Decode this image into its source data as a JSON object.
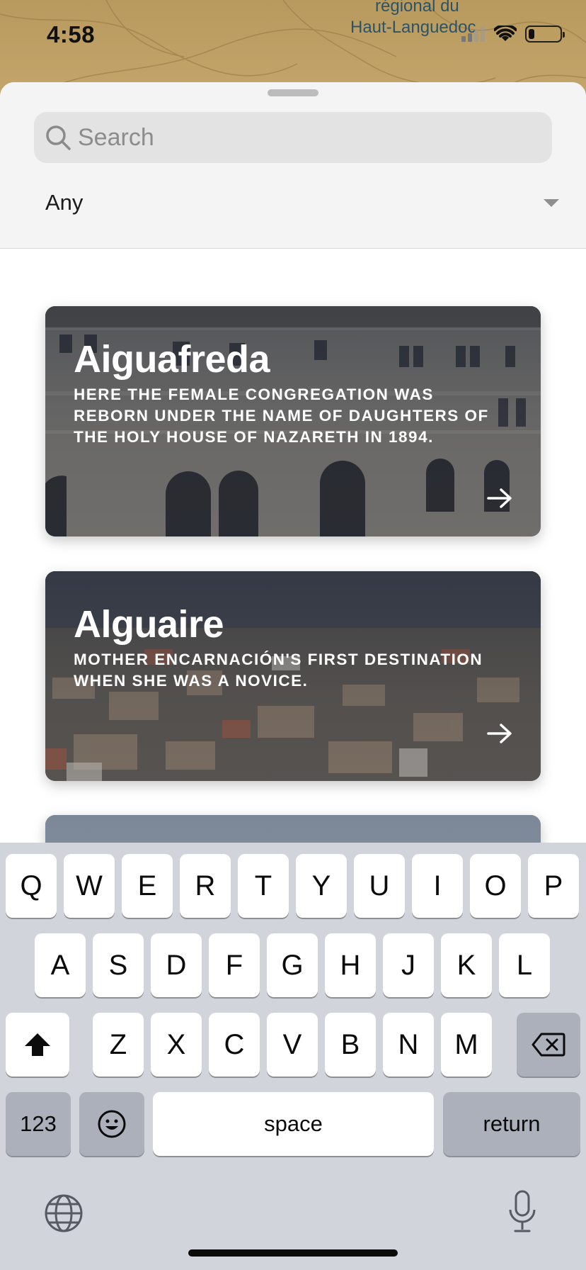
{
  "status_bar": {
    "time": "4:58"
  },
  "map": {
    "label_line1": "régional du",
    "label_line2": "Haut-Languedoc"
  },
  "search": {
    "placeholder": "Search",
    "value": ""
  },
  "filter": {
    "selected": "Any"
  },
  "cards": [
    {
      "title": "Aiguafreda",
      "description": "HERE THE FEMALE CONGREGATION WAS REBORN UNDER THE NAME OF DAUGHTERS OF THE HOLY HOUSE OF NAZARETH IN 1894."
    },
    {
      "title": "Alguaire",
      "description": "MOTHER ENCARNACIÓN'S FIRST DESTINATION WHEN SHE WAS A NOVICE."
    }
  ],
  "keyboard": {
    "row1": [
      "Q",
      "W",
      "E",
      "R",
      "T",
      "Y",
      "U",
      "I",
      "O",
      "P"
    ],
    "row2": [
      "A",
      "S",
      "D",
      "F",
      "G",
      "H",
      "J",
      "K",
      "L"
    ],
    "row3": [
      "Z",
      "X",
      "C",
      "V",
      "B",
      "N",
      "M"
    ],
    "numbers_label": "123",
    "space_label": "space",
    "return_label": "return",
    "icons": [
      "shift-icon",
      "backspace-icon",
      "emoji-icon",
      "globe-icon",
      "microphone-icon"
    ]
  }
}
